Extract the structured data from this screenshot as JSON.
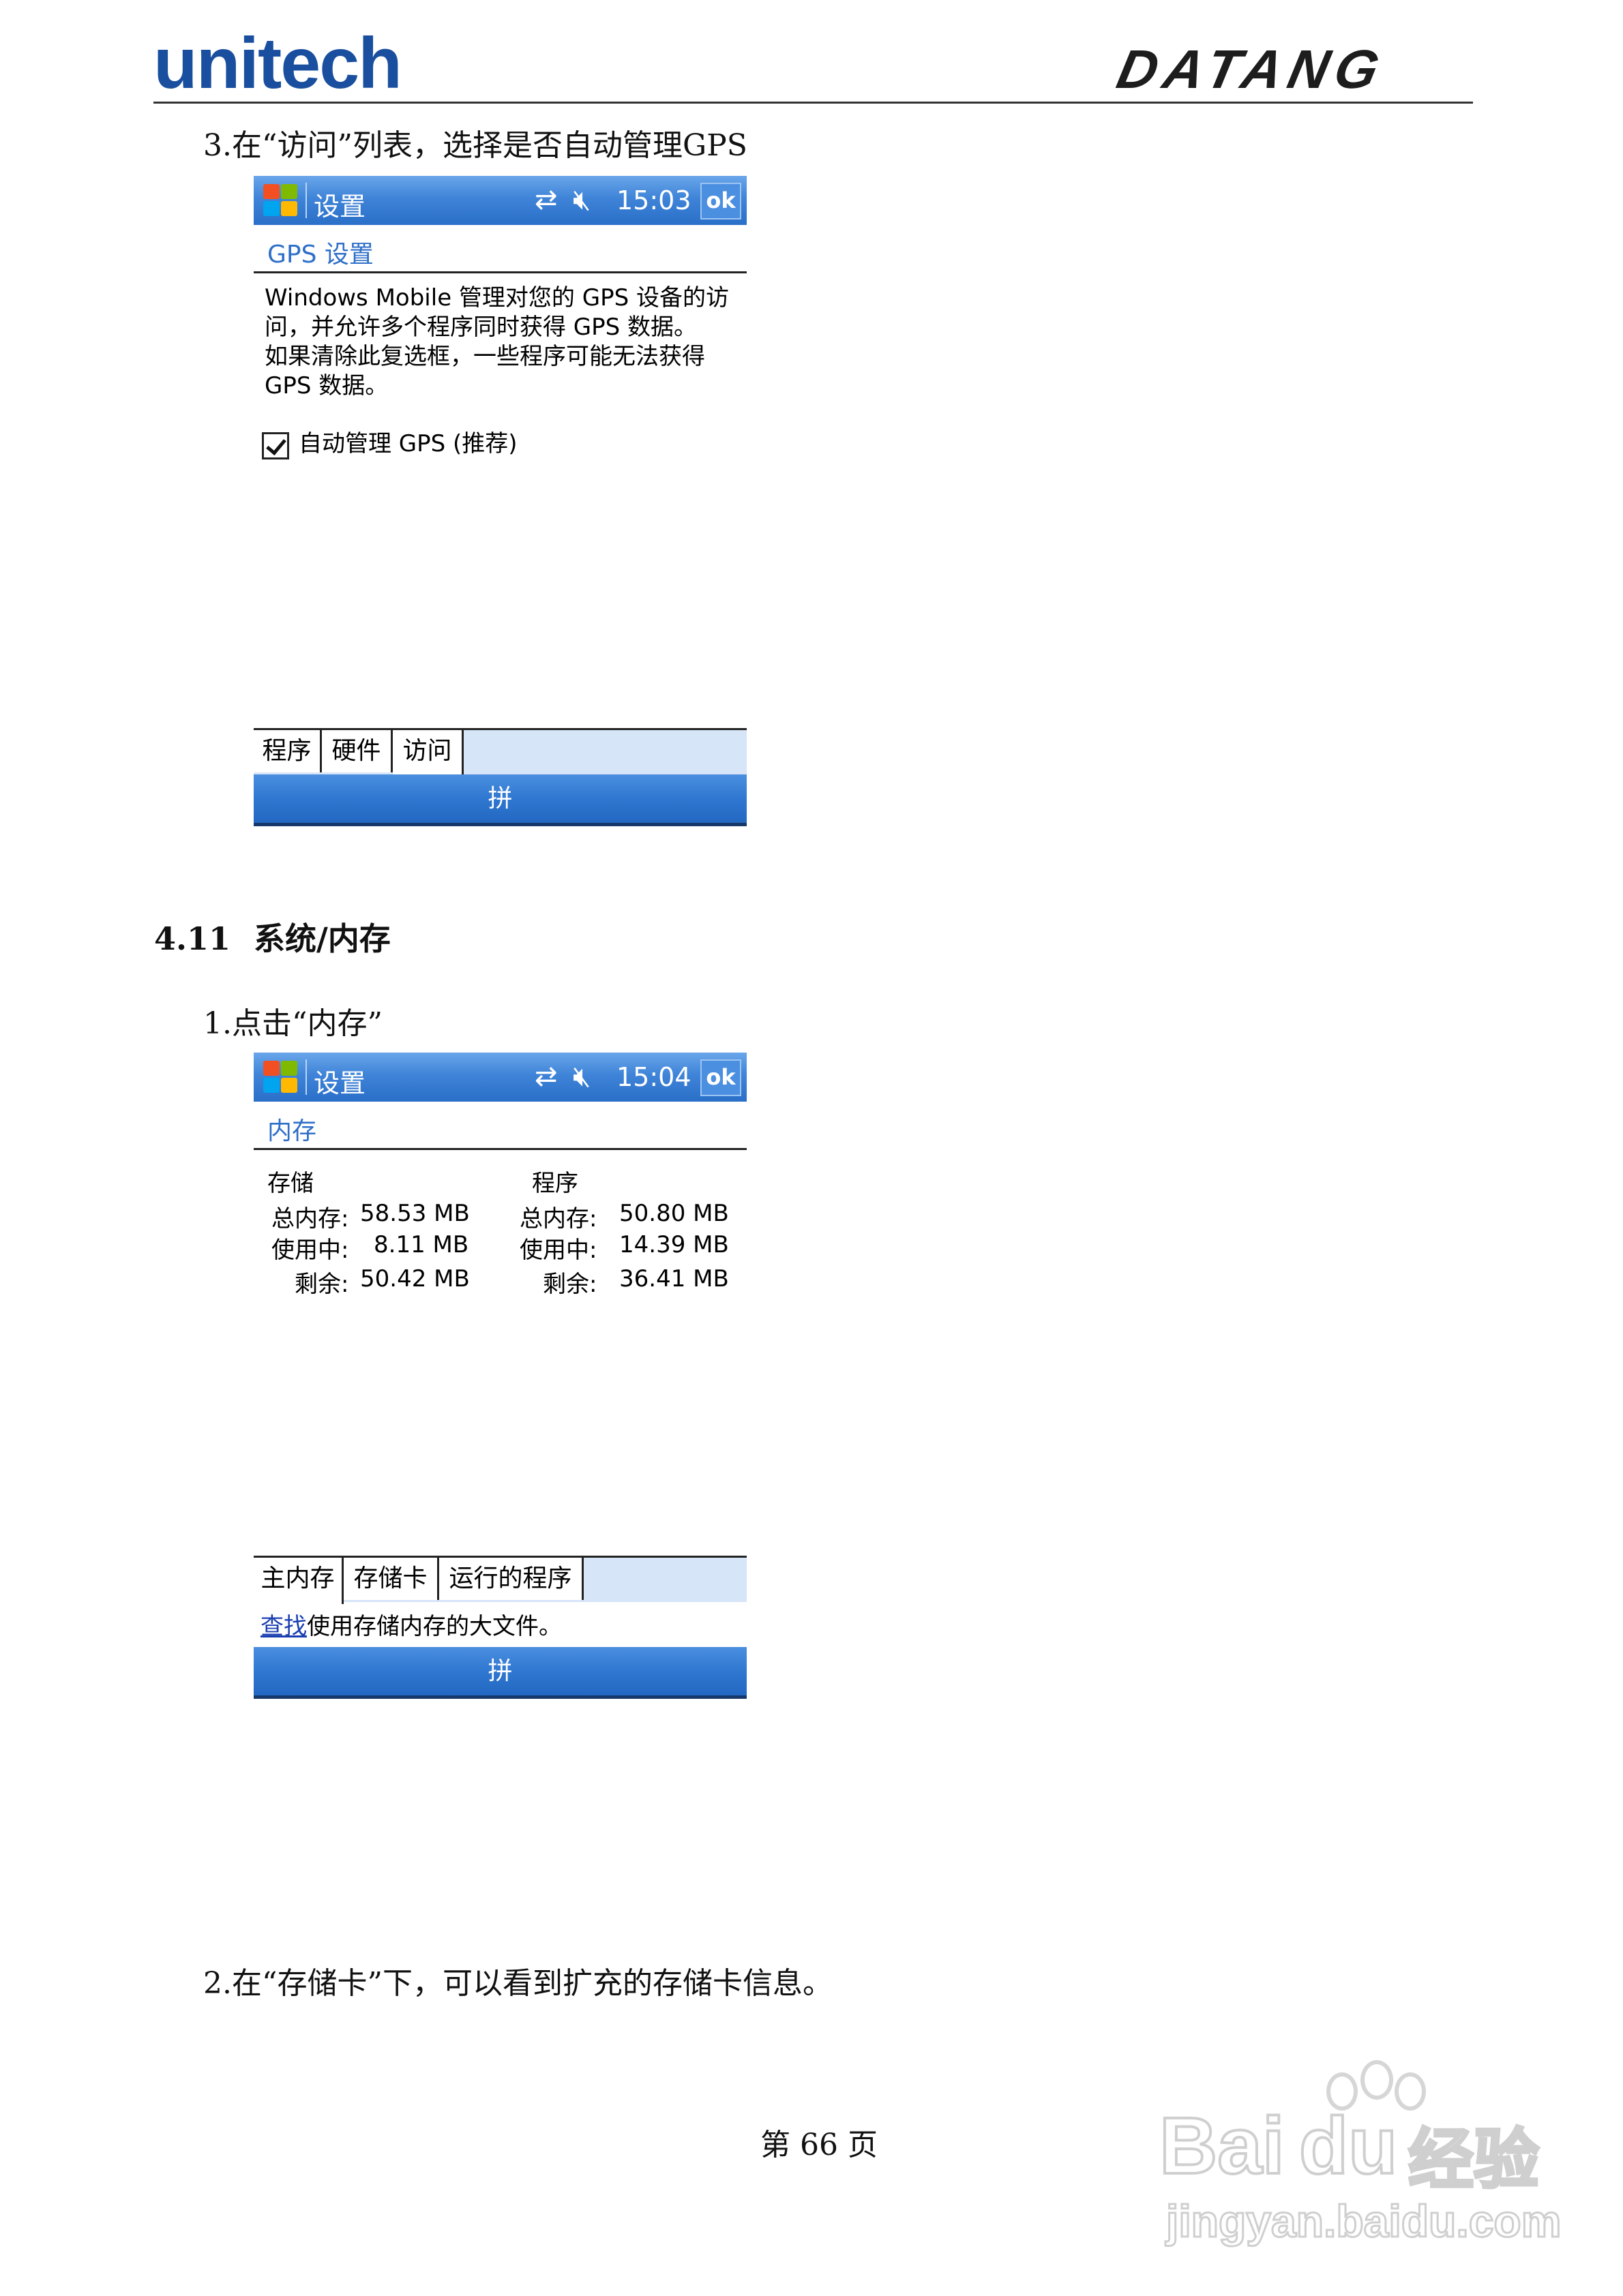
{
  "header": {
    "left_logo": "unitech",
    "right_logo": "DATANG"
  },
  "step_gps": "3.在“访问”列表，选择是否自动管理GPS",
  "screen_gps": {
    "title": "设置",
    "time": "15:03",
    "ok": "ok",
    "heading": "GPS 设置",
    "body_lines": [
      "Windows Mobile 管理对您的 GPS 设备的访",
      "问，并允许多个程序同时获得 GPS 数据。",
      "如果清除此复选框，一些程序可能无法获得",
      "GPS 数据。"
    ],
    "checkbox_label": "自动管理 GPS (推荐)",
    "checkbox_checked": true,
    "tabs": [
      "程序",
      "硬件",
      "访问"
    ],
    "active_tab": "访问",
    "menu": "拼"
  },
  "section": {
    "number": "4.11",
    "title": "系统/内存"
  },
  "step_memory": "1.点击“内存”",
  "screen_memory": {
    "title": "设置",
    "time": "15:04",
    "ok": "ok",
    "heading": "内存",
    "storage": {
      "label": "存储",
      "total_label": "总内存:",
      "total": "58.53 MB",
      "used_label": "使用中:",
      "used": "8.11 MB",
      "free_label": "剩余:",
      "free": "50.42 MB"
    },
    "program": {
      "label": "程序",
      "total_label": "总内存:",
      "total": "50.80 MB",
      "used_label": "使用中:",
      "used": "14.39 MB",
      "free_label": "剩余:",
      "free": "36.41 MB"
    },
    "tabs": [
      "主内存",
      "存储卡",
      "运行的程序"
    ],
    "active_tab": "主内存",
    "find_link": "查找",
    "find_text": "使用存储内存的大文件。",
    "menu": "拼"
  },
  "step_card": "2.在“存储卡”下，可以看到扩充的存储卡信息。",
  "page_number": "第 66 页",
  "watermark": {
    "brand": "Bai",
    "brand2": "du",
    "product": "经验",
    "url": "jingyan.baidu.com"
  }
}
